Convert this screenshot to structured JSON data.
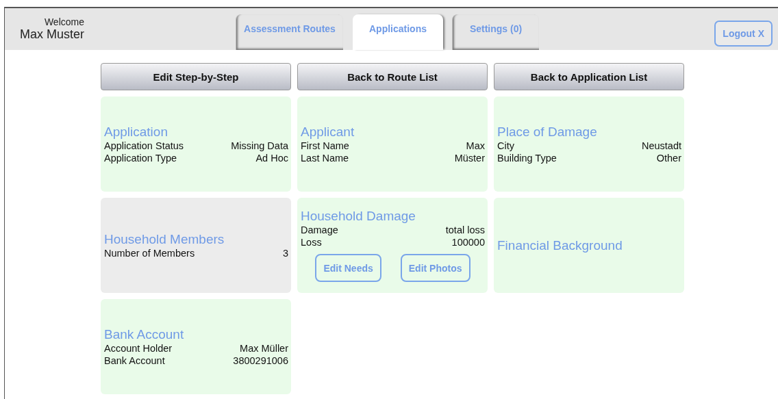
{
  "user": {
    "greeting": "Welcome",
    "name": "Max Muster"
  },
  "tabs": [
    {
      "label": "Assessment Routes",
      "selected": false
    },
    {
      "label": "Applications",
      "selected": true
    },
    {
      "label": "Settings (0)",
      "selected": false
    }
  ],
  "logout_button": "Logout X",
  "actions": [
    "Edit Step-by-Step",
    "Back to Route List",
    "Back to Application List"
  ],
  "cards": [
    {
      "title": "Application",
      "color": "#e9fbe9",
      "fields": [
        {
          "label": "Application Status",
          "value": "Missing Data"
        },
        {
          "label": "Application Type",
          "value": "Ad Hoc"
        }
      ]
    },
    {
      "title": "Applicant",
      "color": "#e9fbe9",
      "fields": [
        {
          "label": "First Name",
          "value": "Max"
        },
        {
          "label": "Last Name",
          "value": "Müster"
        }
      ]
    },
    {
      "title": "Place of Damage",
      "color": "#e9fbe9",
      "fields": [
        {
          "label": "City",
          "value": "Neustadt"
        },
        {
          "label": "Building Type",
          "value": "Other"
        }
      ]
    },
    {
      "title": "Household Members",
      "color": "#ececec",
      "fields": [
        {
          "label": "Number of Members",
          "value": "3"
        }
      ]
    },
    {
      "title": "Household Damage",
      "color": "#e9fbe9",
      "fields": [
        {
          "label": "Damage",
          "value": "total loss"
        },
        {
          "label": "Loss",
          "value": "100000"
        }
      ],
      "buttons": [
        "Edit Needs",
        "Edit Photos"
      ]
    },
    {
      "title": "Financial Background",
      "color": "#e9fbe9"
    },
    {
      "title": "Bank Account",
      "color": "#e9fbe9",
      "fields": [
        {
          "label": "Account Holder",
          "value": "Max Müller"
        },
        {
          "label": "Bank Account",
          "value": "3800291006"
        }
      ]
    }
  ]
}
